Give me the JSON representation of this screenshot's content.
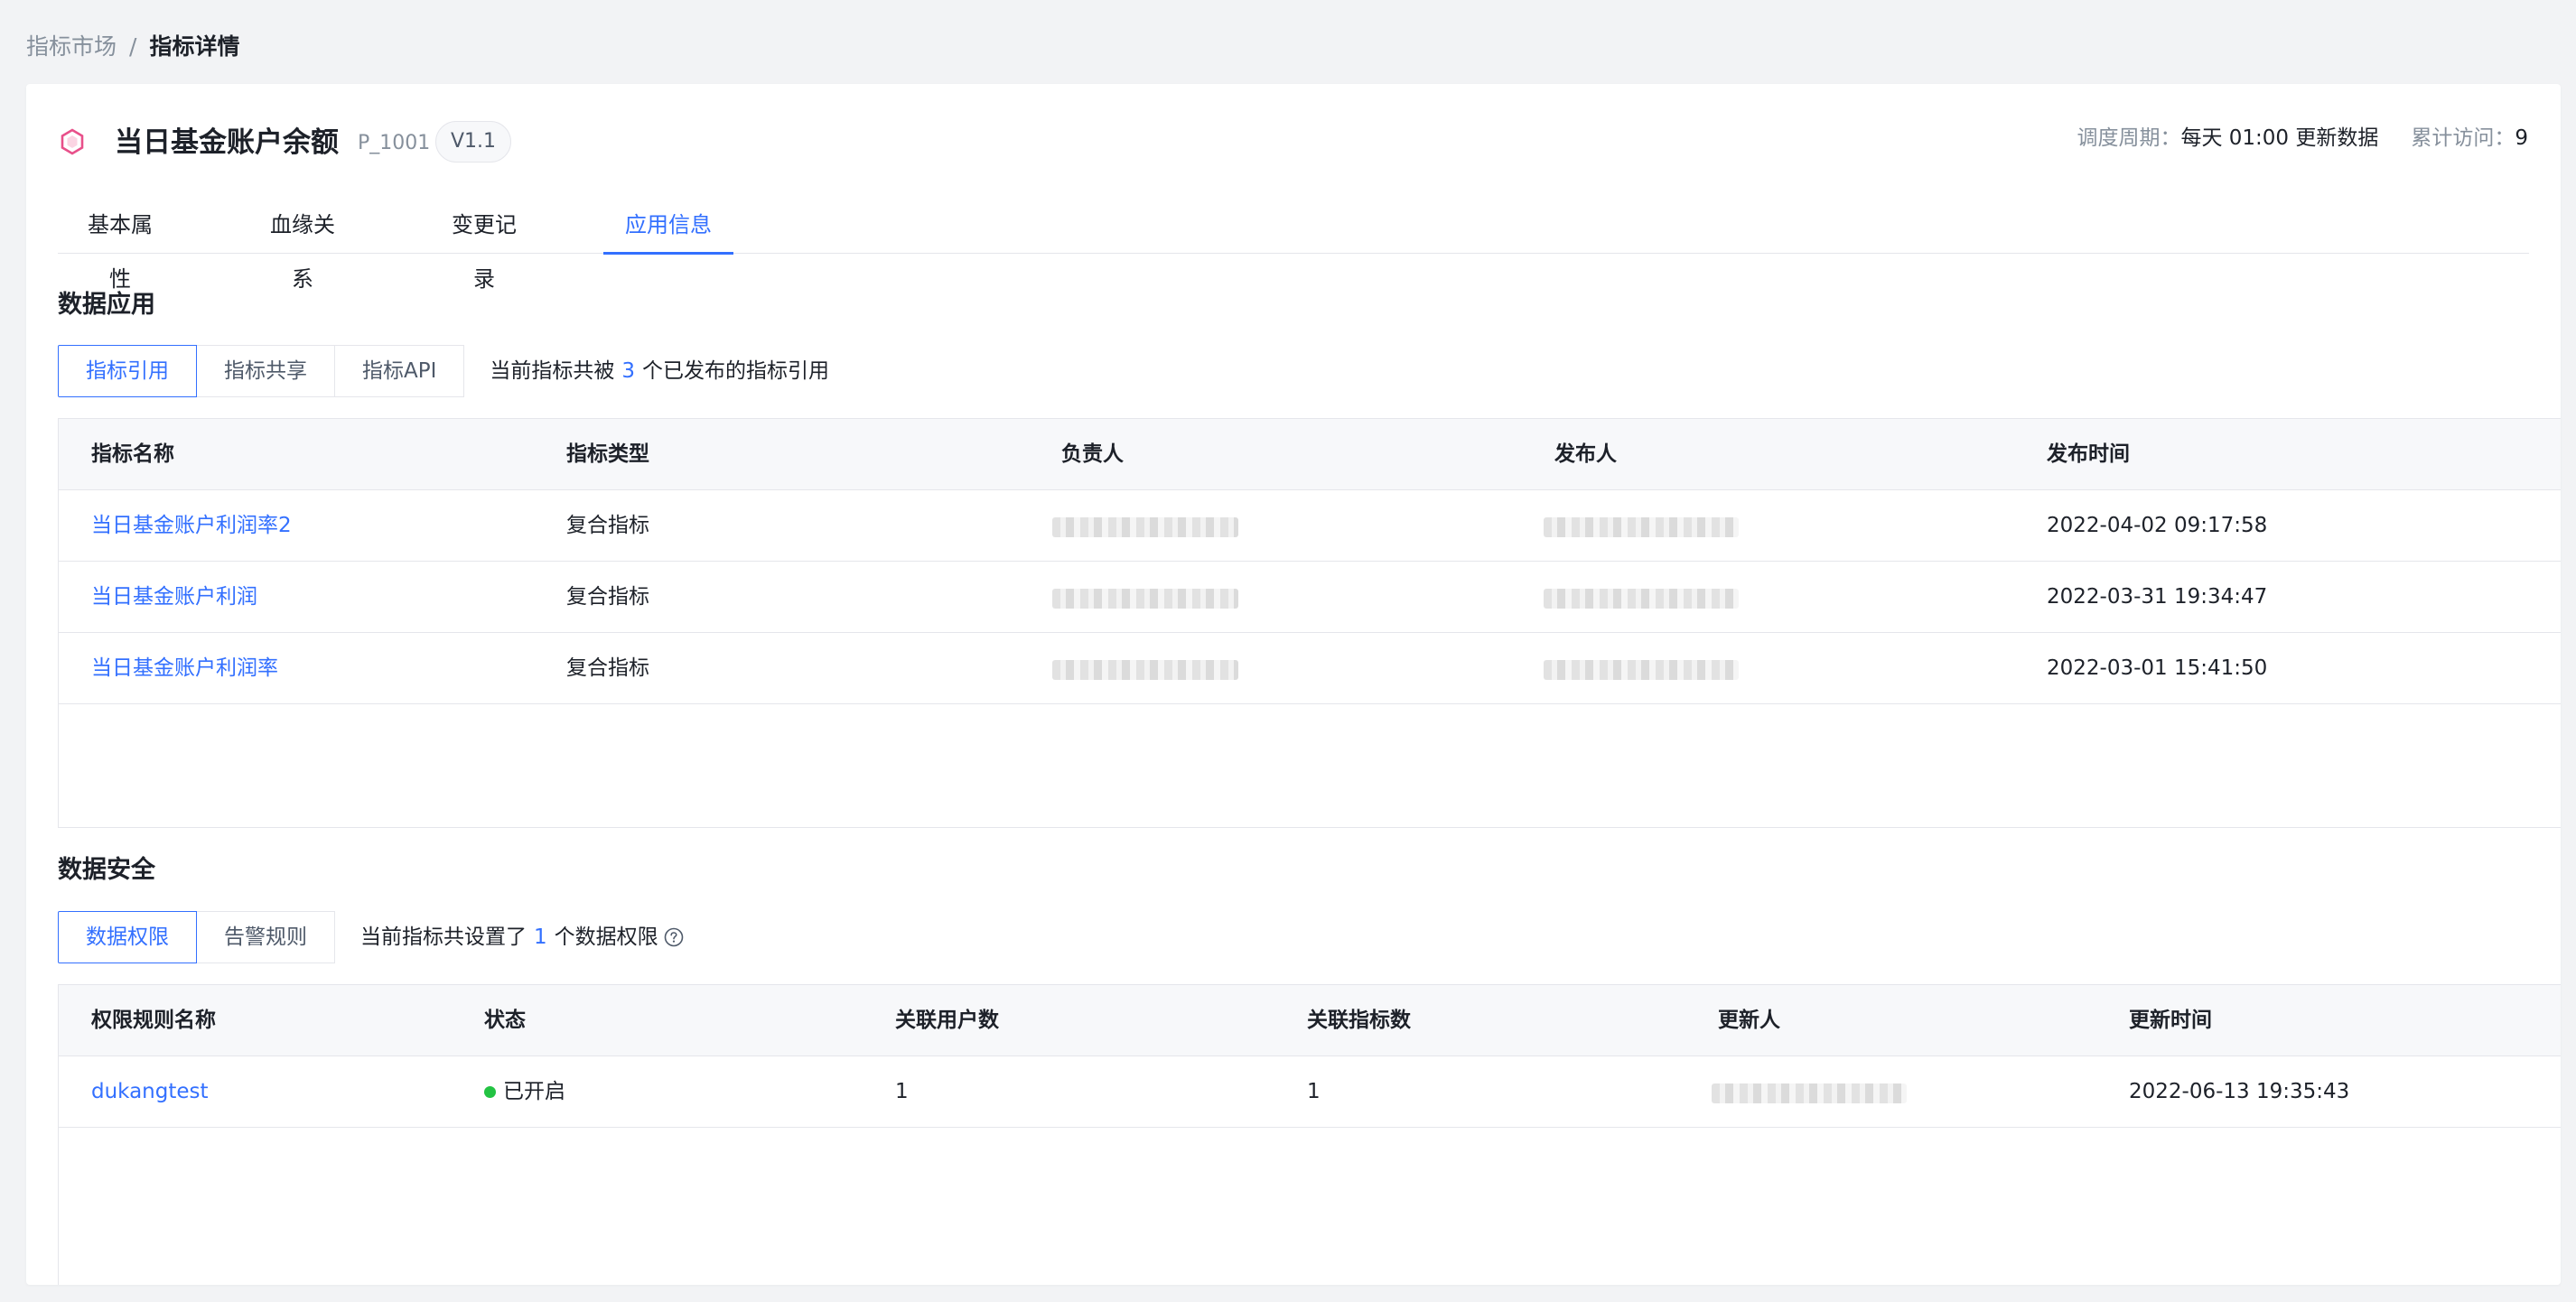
{
  "breadcrumb": {
    "parent": "指标市场",
    "separator": "/",
    "current": "指标详情"
  },
  "header": {
    "title": "当日基金账户余额",
    "code": "P_1001",
    "version": "V1.1",
    "schedule_label": "调度周期：",
    "schedule_value": "每天 01:00 更新数据",
    "visits_label": "累计访问：",
    "visits_value": "9"
  },
  "tabs": [
    {
      "label": "基本属性"
    },
    {
      "label": "血缘关系"
    },
    {
      "label": "变更记录"
    },
    {
      "label": "应用信息",
      "active": true
    }
  ],
  "data_application": {
    "title": "数据应用",
    "segments": [
      "指标引用",
      "指标共享",
      "指标API"
    ],
    "active_segment": "指标引用",
    "info_prefix": "当前指标共被",
    "info_count": "3",
    "info_suffix": "个已发布的指标引用",
    "columns": [
      "指标名称",
      "指标类型",
      "负责人",
      "发布人",
      "发布时间"
    ],
    "rows": [
      {
        "name": "当日基金账户利润率2",
        "type": "复合指标",
        "time": "2022-04-02 09:17:58"
      },
      {
        "name": "当日基金账户利润",
        "type": "复合指标",
        "time": "2022-03-31 19:34:47"
      },
      {
        "name": "当日基金账户利润率",
        "type": "复合指标",
        "time": "2022-03-01 15:41:50"
      }
    ]
  },
  "data_security": {
    "title": "数据安全",
    "segments": [
      "数据权限",
      "告警规则"
    ],
    "active_segment": "数据权限",
    "info_prefix": "当前指标共设置了",
    "info_count": "1",
    "info_suffix": "个数据权限",
    "columns": [
      "权限规则名称",
      "状态",
      "关联用户数",
      "关联指标数",
      "更新人",
      "更新时间"
    ],
    "rows": [
      {
        "name": "dukangtest",
        "status": "已开启",
        "users": "1",
        "metrics": "1",
        "time": "2022-06-13 19:35:43"
      }
    ]
  },
  "colors": {
    "accent": "#3370ff",
    "status_on": "#23c343",
    "icon": "#e8508a"
  },
  "icons": {
    "metric": "hexagon-icon",
    "help": "question-circle-icon"
  }
}
